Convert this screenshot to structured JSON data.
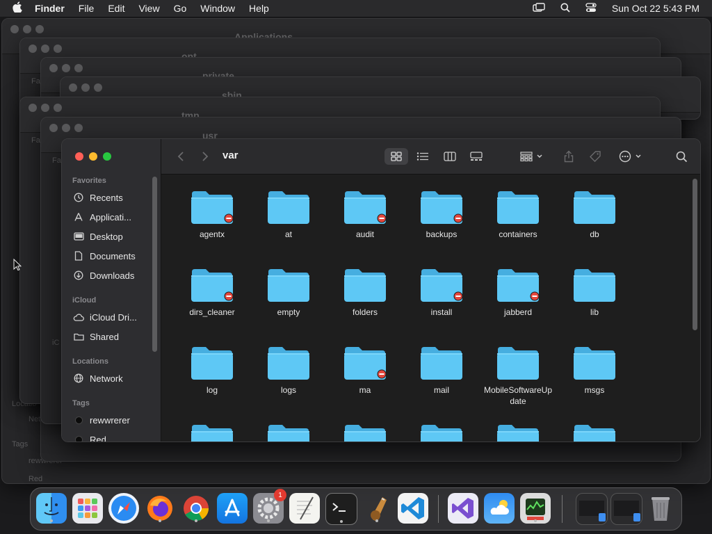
{
  "menubar": {
    "app": "Finder",
    "items": [
      "File",
      "Edit",
      "View",
      "Go",
      "Window",
      "Help"
    ],
    "clock": "Sun Oct 22  5:43 PM"
  },
  "background_windows": [
    {
      "title": "Applications"
    },
    {
      "title": "opt"
    },
    {
      "title": "private"
    },
    {
      "title": "sbin"
    },
    {
      "title": "tmp"
    },
    {
      "title": "usr"
    }
  ],
  "background_sidebar_fragments": [
    "Fa",
    "Fa",
    "Fa",
    "Fa",
    "iC",
    "iC",
    "Lo",
    "Lo",
    "Ta",
    "Ta",
    "iC",
    "Locatio",
    "Netw",
    "Tags",
    "rewwrerer",
    "Red"
  ],
  "finder": {
    "title": "var",
    "sidebar": {
      "favorites_header": "Favorites",
      "favorites": [
        {
          "label": "Recents",
          "icon": "clock-icon"
        },
        {
          "label": "Applicati...",
          "icon": "applications-icon"
        },
        {
          "label": "Desktop",
          "icon": "desktop-icon"
        },
        {
          "label": "Documents",
          "icon": "document-icon"
        },
        {
          "label": "Downloads",
          "icon": "download-icon"
        }
      ],
      "icloud_header": "iCloud",
      "icloud": [
        {
          "label": "iCloud Dri...",
          "icon": "cloud-icon"
        },
        {
          "label": "Shared",
          "icon": "shared-folder-icon"
        }
      ],
      "locations_header": "Locations",
      "locations": [
        {
          "label": "Network",
          "icon": "globe-icon"
        }
      ],
      "tags_header": "Tags",
      "tags": [
        {
          "label": "rewwrerer"
        },
        {
          "label": "Red"
        }
      ]
    },
    "folders": [
      {
        "name": "agentx",
        "restricted": true
      },
      {
        "name": "at",
        "restricted": false
      },
      {
        "name": "audit",
        "restricted": true
      },
      {
        "name": "backups",
        "restricted": true
      },
      {
        "name": "containers",
        "restricted": false
      },
      {
        "name": "db",
        "restricted": false
      },
      {
        "name": "dirs_cleaner",
        "restricted": true
      },
      {
        "name": "empty",
        "restricted": false
      },
      {
        "name": "folders",
        "restricted": false
      },
      {
        "name": "install",
        "restricted": true
      },
      {
        "name": "jabberd",
        "restricted": true
      },
      {
        "name": "lib",
        "restricted": false
      },
      {
        "name": "log",
        "restricted": false
      },
      {
        "name": "logs",
        "restricted": false
      },
      {
        "name": "ma",
        "restricted": true
      },
      {
        "name": "mail",
        "restricted": false
      },
      {
        "name": "MobileSoftwareUpdate",
        "restricted": false
      },
      {
        "name": "msgs",
        "restricted": false
      }
    ]
  },
  "dock": {
    "apps": [
      "finder",
      "launchpad",
      "safari",
      "firefox",
      "chrome",
      "app-store",
      "system-settings",
      "textedit",
      "terminal",
      "instruments",
      "vscode",
      "visual-studio",
      "weather",
      "activity-monitor"
    ],
    "settings_badge": "1"
  },
  "colors": {
    "folder": "#5ec8f5",
    "folder_tab": "#46aee0",
    "restricted_badge": "#e5473d",
    "close": "#ff5f57",
    "minimize": "#febc2e",
    "maximize": "#28c840"
  }
}
